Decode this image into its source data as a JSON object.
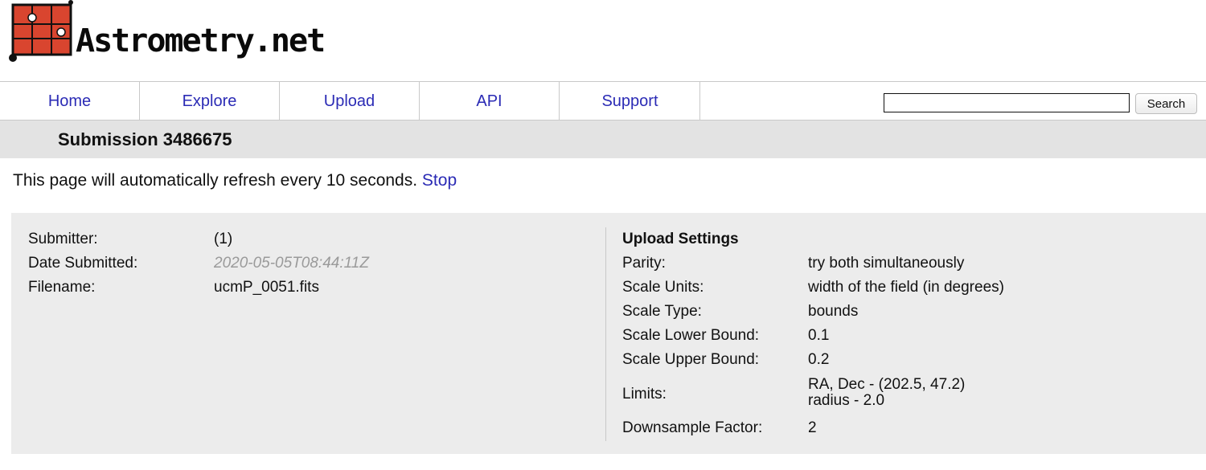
{
  "brand": {
    "logo_text": "Astrometry.net",
    "logo_color": "#d9452f"
  },
  "nav": {
    "items": [
      "Home",
      "Explore",
      "Upload",
      "API",
      "Support"
    ],
    "search_placeholder": "",
    "search_button": "Search",
    "link_color": "#2b2bb5"
  },
  "page_title": "Submission 3486675",
  "refresh": {
    "message": "This page will automatically refresh every 10 seconds.",
    "stop_link": "Stop"
  },
  "submission": {
    "submitter_label": "Submitter:",
    "submitter_value": "(1)",
    "date_label": "Date Submitted:",
    "date_value": "2020-05-05T08:44:11Z",
    "filename_label": "Filename:",
    "filename_value": "ucmP_0051.fits"
  },
  "settings": {
    "heading": "Upload Settings",
    "parity_label": "Parity:",
    "parity_value": "try both simultaneously",
    "scale_units_label": "Scale Units:",
    "scale_units_value": "width of the field (in degrees)",
    "scale_type_label": "Scale Type:",
    "scale_type_value": "bounds",
    "scale_lower_label": "Scale Lower Bound:",
    "scale_lower_value": "0.1",
    "scale_upper_label": "Scale Upper Bound:",
    "scale_upper_value": "0.2",
    "limits_label": "Limits:",
    "limits_value_line1": "RA, Dec - (202.5, 47.2)",
    "limits_value_line2": "radius - 2.0",
    "downsample_label": "Downsample Factor:",
    "downsample_value": "2"
  }
}
